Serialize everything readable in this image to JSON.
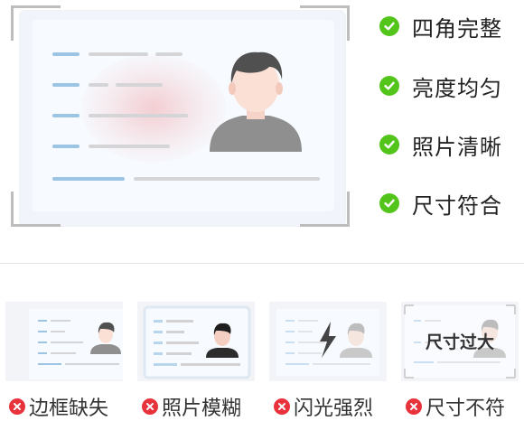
{
  "requirements": [
    {
      "label": "四角完整",
      "status": "ok"
    },
    {
      "label": "亮度均匀",
      "status": "ok"
    },
    {
      "label": "照片清晰",
      "status": "ok"
    },
    {
      "label": "尺寸符合",
      "status": "ok"
    }
  ],
  "bad_examples": [
    {
      "label": "边框缺失",
      "status": "error",
      "overlay_text": ""
    },
    {
      "label": "照片模糊",
      "status": "error",
      "overlay_text": ""
    },
    {
      "label": "闪光强烈",
      "status": "error",
      "overlay_text": ""
    },
    {
      "label": "尺寸不符",
      "status": "error",
      "overlay_text": "尺寸过大"
    }
  ],
  "colors": {
    "ok": "#52c41a",
    "error": "#e8323c",
    "card_line_blue": "#9cc4e3",
    "card_line_gray": "#d5d5d7"
  }
}
